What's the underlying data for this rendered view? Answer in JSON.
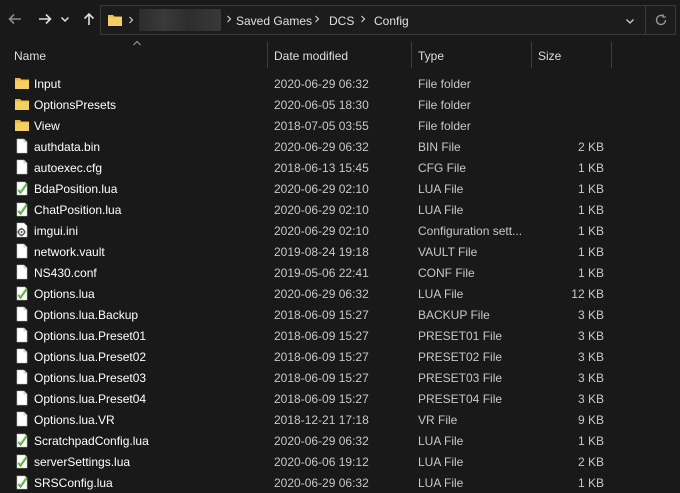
{
  "navigation": {
    "back_icon": "arrow-left-icon",
    "forward_icon": "arrow-right-icon",
    "recent_icon": "chevron-down-icon",
    "up_icon": "arrow-up-icon"
  },
  "address": {
    "crumbs": [
      "Saved Games",
      "DCS",
      "Config"
    ]
  },
  "columns": {
    "name": "Name",
    "date": "Date modified",
    "type": "Type",
    "size": "Size"
  },
  "files": [
    {
      "name": "Input",
      "date": "2020-06-29 06:32",
      "type": "File folder",
      "size": "",
      "icon": "folder-icon"
    },
    {
      "name": "OptionsPresets",
      "date": "2020-06-05 18:30",
      "type": "File folder",
      "size": "",
      "icon": "folder-icon"
    },
    {
      "name": "View",
      "date": "2018-07-05 03:55",
      "type": "File folder",
      "size": "",
      "icon": "folder-icon"
    },
    {
      "name": "authdata.bin",
      "date": "2020-06-29 06:32",
      "type": "BIN File",
      "size": "2 KB",
      "icon": "file-icon"
    },
    {
      "name": "autoexec.cfg",
      "date": "2018-06-13 15:45",
      "type": "CFG File",
      "size": "1 KB",
      "icon": "file-icon"
    },
    {
      "name": "BdaPosition.lua",
      "date": "2020-06-29 02:10",
      "type": "LUA File",
      "size": "1 KB",
      "icon": "lua-file-icon"
    },
    {
      "name": "ChatPosition.lua",
      "date": "2020-06-29 02:10",
      "type": "LUA File",
      "size": "1 KB",
      "icon": "lua-file-icon"
    },
    {
      "name": "imgui.ini",
      "date": "2020-06-29 02:10",
      "type": "Configuration sett...",
      "size": "1 KB",
      "icon": "config-file-icon"
    },
    {
      "name": "network.vault",
      "date": "2019-08-24 19:18",
      "type": "VAULT File",
      "size": "1 KB",
      "icon": "file-icon"
    },
    {
      "name": "NS430.conf",
      "date": "2019-05-06 22:41",
      "type": "CONF File",
      "size": "1 KB",
      "icon": "file-icon"
    },
    {
      "name": "Options.lua",
      "date": "2020-06-29 06:32",
      "type": "LUA File",
      "size": "12 KB",
      "icon": "lua-file-icon"
    },
    {
      "name": "Options.lua.Backup",
      "date": "2018-06-09 15:27",
      "type": "BACKUP File",
      "size": "3 KB",
      "icon": "file-icon"
    },
    {
      "name": "Options.lua.Preset01",
      "date": "2018-06-09 15:27",
      "type": "PRESET01 File",
      "size": "3 KB",
      "icon": "file-icon"
    },
    {
      "name": "Options.lua.Preset02",
      "date": "2018-06-09 15:27",
      "type": "PRESET02 File",
      "size": "3 KB",
      "icon": "file-icon"
    },
    {
      "name": "Options.lua.Preset03",
      "date": "2018-06-09 15:27",
      "type": "PRESET03 File",
      "size": "3 KB",
      "icon": "file-icon"
    },
    {
      "name": "Options.lua.Preset04",
      "date": "2018-06-09 15:27",
      "type": "PRESET04 File",
      "size": "3 KB",
      "icon": "file-icon"
    },
    {
      "name": "Options.lua.VR",
      "date": "2018-12-21 17:18",
      "type": "VR File",
      "size": "9 KB",
      "icon": "file-icon"
    },
    {
      "name": "ScratchpadConfig.lua",
      "date": "2020-06-29 06:32",
      "type": "LUA File",
      "size": "1 KB",
      "icon": "lua-file-icon"
    },
    {
      "name": "serverSettings.lua",
      "date": "2020-06-06 19:12",
      "type": "LUA File",
      "size": "2 KB",
      "icon": "lua-file-icon"
    },
    {
      "name": "SRSConfig.lua",
      "date": "2020-06-29 06:32",
      "type": "LUA File",
      "size": "1 KB",
      "icon": "lua-file-icon"
    }
  ],
  "colors": {
    "background": "#191919",
    "folder": "#f0c050",
    "text": "#ffffff",
    "secondary_text": "#c8c8c8"
  }
}
